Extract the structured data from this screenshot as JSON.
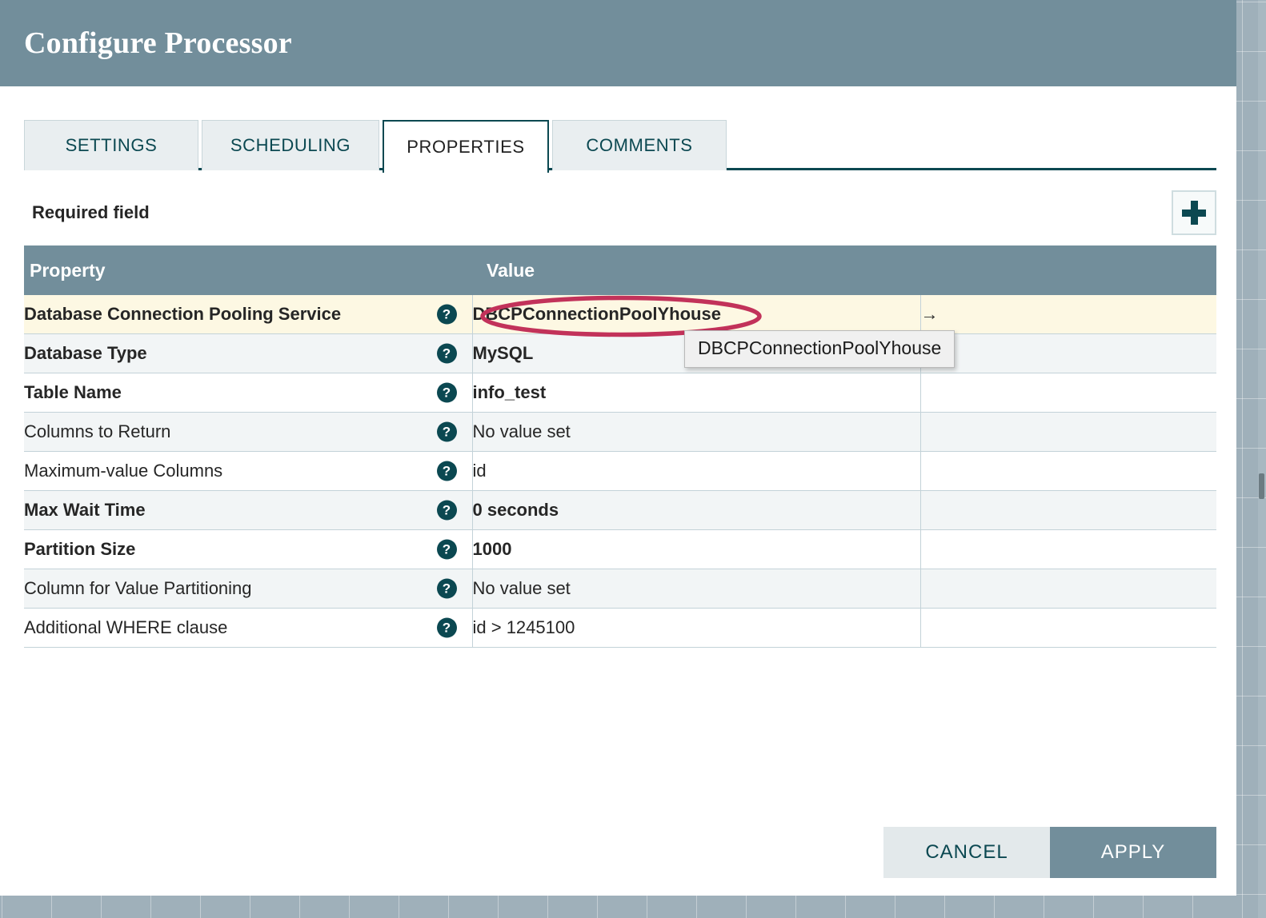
{
  "dialog": {
    "title": "Configure Processor"
  },
  "tabs": [
    {
      "id": "settings",
      "label": "SETTINGS",
      "active": false
    },
    {
      "id": "scheduling",
      "label": "SCHEDULING",
      "active": false
    },
    {
      "id": "properties",
      "label": "PROPERTIES",
      "active": true
    },
    {
      "id": "comments",
      "label": "COMMENTS",
      "active": false
    }
  ],
  "subhead": {
    "required_field_label": "Required field",
    "add_button_icon": "plus-icon"
  },
  "table": {
    "headers": {
      "property": "Property",
      "value": "Value",
      "extra": ""
    },
    "help_icon_glyph": "?",
    "rows": [
      {
        "property": "Database Connection Pooling Service",
        "value": "DBCPConnectionPoolYhouse",
        "required": true,
        "empty": false,
        "highlight": true,
        "extra": "→"
      },
      {
        "property": "Database Type",
        "value": "MySQL",
        "required": true,
        "empty": false,
        "highlight": false,
        "extra": ""
      },
      {
        "property": "Table Name",
        "value": "info_test",
        "required": true,
        "empty": false,
        "highlight": false,
        "extra": ""
      },
      {
        "property": "Columns to Return",
        "value": "No value set",
        "required": false,
        "empty": true,
        "highlight": false,
        "extra": ""
      },
      {
        "property": "Maximum-value Columns",
        "value": "id",
        "required": false,
        "empty": false,
        "highlight": false,
        "extra": ""
      },
      {
        "property": "Max Wait Time",
        "value": "0 seconds",
        "required": true,
        "empty": false,
        "highlight": false,
        "extra": ""
      },
      {
        "property": "Partition Size",
        "value": "1000",
        "required": true,
        "empty": false,
        "highlight": false,
        "extra": ""
      },
      {
        "property": "Column for Value Partitioning",
        "value": "No value set",
        "required": false,
        "empty": true,
        "highlight": false,
        "extra": ""
      },
      {
        "property": "Additional WHERE clause",
        "value": "id > 1245100",
        "required": false,
        "empty": false,
        "highlight": false,
        "extra": ""
      }
    ]
  },
  "tooltip": {
    "text": "DBCPConnectionPoolYhouse"
  },
  "annotation": {
    "shape": "ellipse",
    "color": "#c2325a",
    "targets": "DBCPConnectionPoolYhouse"
  },
  "footer": {
    "cancel_label": "CANCEL",
    "apply_label": "APPLY"
  },
  "colors": {
    "header_bar": "#728e9b",
    "accent_teal": "#0b4851",
    "tab_inactive_bg": "#e9eef0",
    "row_highlight": "#fdf8e3",
    "row_stripe": "#f2f5f6",
    "annotation": "#c2325a",
    "canvas": "#9fb0ba"
  }
}
